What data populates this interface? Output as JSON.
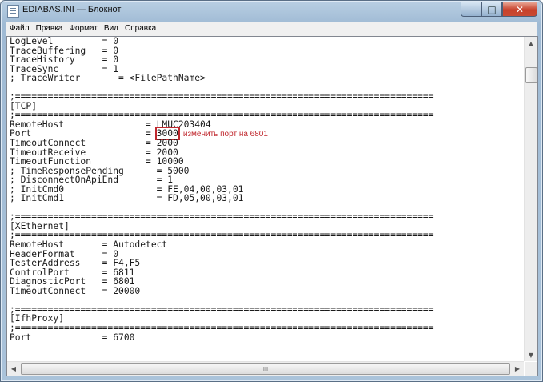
{
  "window": {
    "title": "EDIABAS.INI — Блокнот"
  },
  "titlebar_buttons": {
    "minimize": "–",
    "maximize": "□",
    "close": "✕"
  },
  "menu": [
    "Файл",
    "Правка",
    "Формат",
    "Вид",
    "Справка"
  ],
  "editor": {
    "lines": [
      "LogLevel         = 0",
      "TraceBuffering   = 0",
      "TraceHistory     = 0",
      "TraceSync        = 1",
      "; TraceWriter       = <FilePathName>",
      "",
      ";=============================================================================",
      "[TCP]",
      ";=============================================================================",
      "RemoteHost               = LMUC203404",
      "Port                     = 3000",
      "TimeoutConnect           = 2000",
      "TimeoutReceive           = 2000",
      "TimeoutFunction          = 10000",
      "; TimeResponsePending      = 5000",
      "; DisconnectOnApiEnd       = 1",
      "; InitCmd0                 = FE,04,00,03,01",
      "; InitCmd1                 = FD,05,00,03,01",
      "",
      ";=============================================================================",
      "[XEthernet]",
      ";=============================================================================",
      "RemoteHost       = Autodetect",
      "HeaderFormat     = 0",
      "TesterAddress    = F4,F5",
      "ControlPort      = 6811",
      "DiagnosticPort   = 6801",
      "TimeoutConnect   = 20000",
      "",
      ";=============================================================================",
      "[IfhProxy]",
      ";=============================================================================",
      "Port             = 6700"
    ],
    "highlight": {
      "line_index": 10,
      "prefix": "Port                     = ",
      "value": "3000",
      "note": "изменить порт на 6801",
      "color": "#c0282e"
    }
  },
  "scrollbar": {
    "up": "▲",
    "down": "▼",
    "left": "◀",
    "right": "▶",
    "grip": "III"
  }
}
